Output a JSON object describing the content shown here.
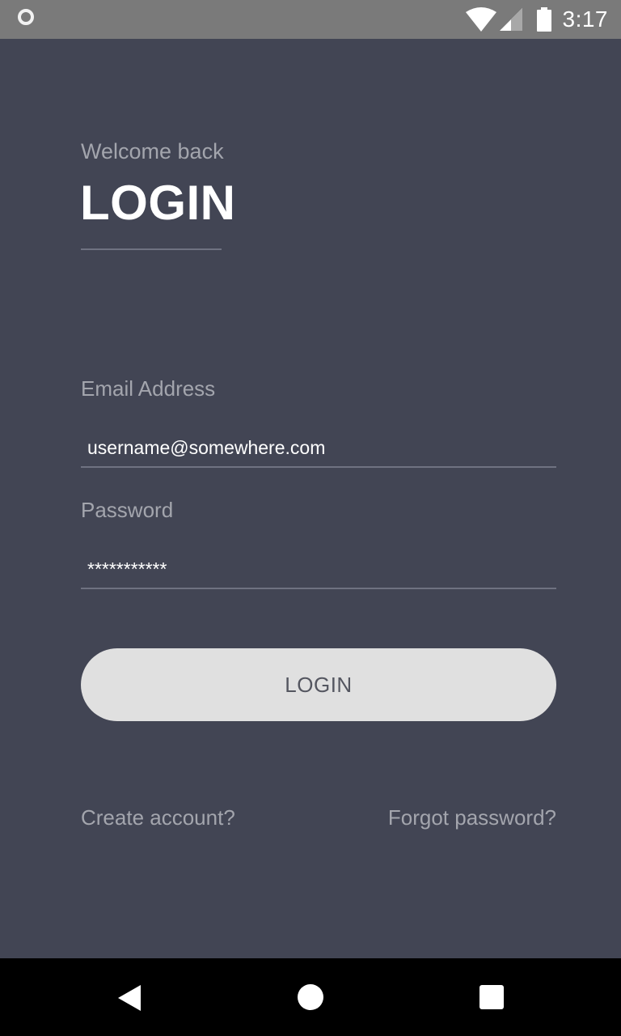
{
  "status_bar": {
    "time": "3:17",
    "icons": [
      "record-icon",
      "wifi-icon",
      "signal-icon",
      "battery-icon"
    ]
  },
  "login": {
    "welcome": "Welcome back",
    "title": "LOGIN",
    "email_label": "Email Address",
    "email_value": "username@somewhere.com",
    "password_label": "Password",
    "password_value": "***********",
    "button_label": "LOGIN",
    "create_account": "Create account?",
    "forgot_password": "Forgot password?"
  },
  "nav_bar": {
    "icons": [
      "back-icon",
      "home-icon",
      "recents-icon"
    ]
  },
  "colors": {
    "background": "#424554",
    "status_bar": "#7a7a7a",
    "button": "#e0e0e0",
    "muted_text": "#a3a5ad"
  }
}
